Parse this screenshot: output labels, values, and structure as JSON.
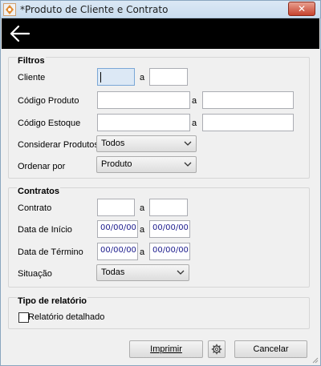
{
  "window": {
    "title": "*Produto de Cliente e Contrato",
    "close_glyph": "✕"
  },
  "filtros": {
    "title": "Filtros",
    "cliente_label": "Cliente",
    "cliente_from": "",
    "cliente_sep": "a",
    "cliente_to": "",
    "codigo_produto_label": "Código Produto",
    "codigo_produto_from": "",
    "codigo_produto_sep": "a",
    "codigo_produto_to": "",
    "codigo_estoque_label": "Código Estoque",
    "codigo_estoque_from": "",
    "codigo_estoque_sep": "a",
    "codigo_estoque_to": "",
    "considerar_label": "Considerar Produtos",
    "considerar_value": "Todos",
    "ordenar_label": "Ordenar por",
    "ordenar_value": "Produto"
  },
  "contratos": {
    "title": "Contratos",
    "contrato_label": "Contrato",
    "contrato_from": "",
    "contrato_sep": "a",
    "contrato_to": "",
    "inicio_label": "Data de Início",
    "inicio_from": "00/00/00",
    "inicio_sep": "a",
    "inicio_to": "00/00/00",
    "termino_label": "Data de Término",
    "termino_from": "00/00/00",
    "termino_sep": "a",
    "termino_to": "00/00/00",
    "situacao_label": "Situação",
    "situacao_value": "Todas"
  },
  "tipo": {
    "title": "Tipo de relatório",
    "detalhado_label": "Relatório detalhado",
    "detalhado_checked": false
  },
  "actions": {
    "imprimir_label": "Imprimir",
    "cancelar_label": "Cancelar"
  },
  "colors": {
    "topbar": "#000000",
    "window_bg": "#f0f0f0",
    "close": "#c7432e"
  }
}
